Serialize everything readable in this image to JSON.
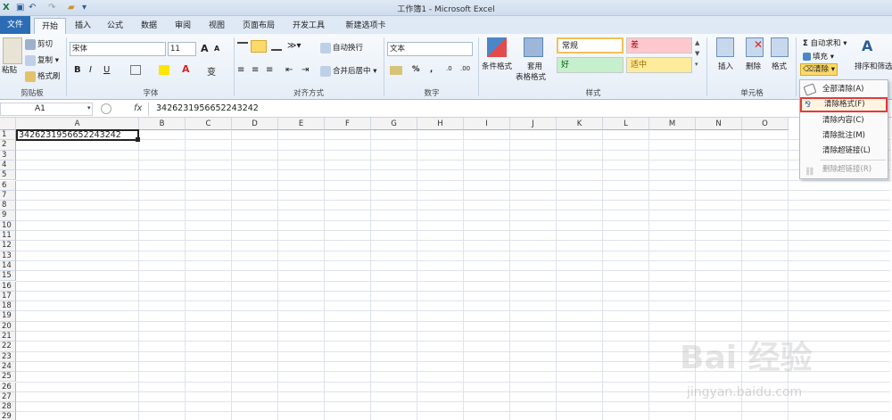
{
  "window": {
    "title": "工作簿1 - Microsoft Excel"
  },
  "tabs": [
    "文件",
    "开始",
    "插入",
    "公式",
    "数据",
    "审阅",
    "视图",
    "页面布局",
    "开发工具",
    "新建选项卡"
  ],
  "clipboard": {
    "cut": "剪切",
    "copy": "复制",
    "copy_arrow": "▾",
    "format_painter": "格式刷",
    "paste": "粘贴",
    "label": "剪贴板"
  },
  "font": {
    "name": "宋体",
    "size": "11",
    "grow": "A",
    "shrink": "A",
    "bold": "B",
    "italic": "I",
    "underline": "U",
    "label": "字体"
  },
  "alignment": {
    "wrap": "自动换行",
    "merge": "合并后居中",
    "label": "对齐方式"
  },
  "number": {
    "format": "文本",
    "percent": "%",
    "comma": ",",
    "inc_dec": ".0",
    "dec_dec": ".00",
    "label": "数字"
  },
  "styles": {
    "conditional": "条件格式",
    "table_format_1": "套用",
    "table_format_2": "表格格式",
    "normal": "常规",
    "bad": "差",
    "good": "好",
    "neutral": "适中",
    "label": "样式"
  },
  "cells": {
    "insert": "插入",
    "delete": "删除",
    "format": "格式",
    "label": "单元格"
  },
  "editing": {
    "autosum": "自动求和",
    "fill": "填充",
    "clear": "清除",
    "sort": "排序和筛选",
    "sigma": "Σ"
  },
  "formula_bar": {
    "cell_ref": "A1",
    "fx": "fx",
    "value": "3426231956652243242"
  },
  "columns": [
    "A",
    "B",
    "C",
    "D",
    "E",
    "F",
    "G",
    "H",
    "I",
    "J",
    "K",
    "L",
    "M",
    "N",
    "O"
  ],
  "rows": [
    "1",
    "2",
    "3",
    "4",
    "5",
    "6",
    "7",
    "8",
    "9",
    "10",
    "11",
    "12",
    "13",
    "14",
    "15",
    "16",
    "17",
    "18",
    "19",
    "20",
    "21",
    "22",
    "23",
    "24",
    "25",
    "26",
    "27",
    "28",
    "29",
    "30"
  ],
  "cell_a1": "3426231956652243242",
  "clear_menu": [
    {
      "label": "全部清除(A)",
      "icon": "eraser-icon",
      "enabled": true
    },
    {
      "label": "清除格式(F)",
      "icon": "clear-format-icon",
      "enabled": true,
      "highlighted": true
    },
    {
      "label": "清除内容(C)",
      "icon": "",
      "enabled": true
    },
    {
      "label": "清除批注(M)",
      "icon": "",
      "enabled": true
    },
    {
      "label": "清除超链接(L)",
      "icon": "",
      "enabled": true
    },
    {
      "label": "删除超链接(R)",
      "icon": "unlink-icon",
      "enabled": false
    }
  ],
  "watermark": {
    "brand": "Bai 经验",
    "url": "jingyan.baidu.com"
  },
  "colors": {
    "file_tab": "#2b6cb5",
    "highlight": "#e23b3b",
    "bad_fill": "#ffc7ce",
    "good_fill": "#c6efce",
    "neutral_fill": "#ffeb9c"
  }
}
